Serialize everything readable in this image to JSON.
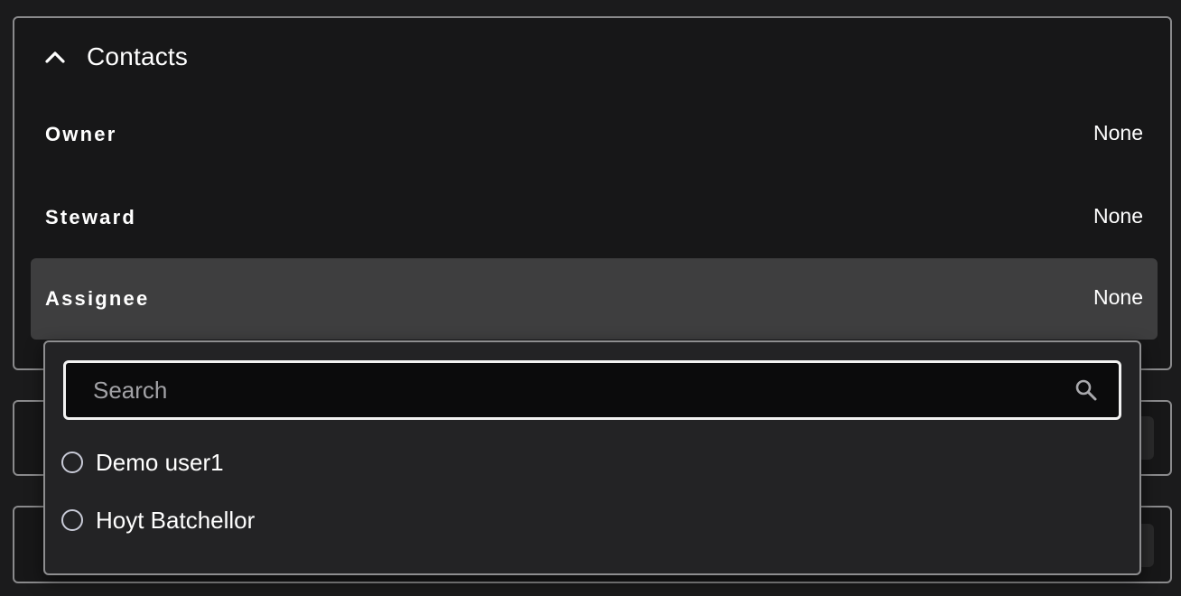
{
  "contacts": {
    "title": "Contacts",
    "fields": [
      {
        "label": "Owner",
        "value": "None"
      },
      {
        "label": "Steward",
        "value": "None"
      },
      {
        "label": "Assignee",
        "value": "None"
      }
    ]
  },
  "dropdown": {
    "search_placeholder": "Search",
    "search_value": "",
    "options": [
      {
        "label": "Demo user1",
        "selected": false
      },
      {
        "label": "Hoyt Batchellor",
        "selected": false
      }
    ]
  },
  "colors": {
    "background": "#1b1b1c",
    "panel": "#171718",
    "border": "#8a8a8c",
    "highlight_row": "#3e3e3f",
    "dropdown": "#232325",
    "search_bg": "#0b0b0c",
    "radio_border": "#c9cbd8"
  },
  "icons": {
    "collapse": "chevron-up-icon",
    "search": "search-icon",
    "option_marker": "radio-icon"
  }
}
